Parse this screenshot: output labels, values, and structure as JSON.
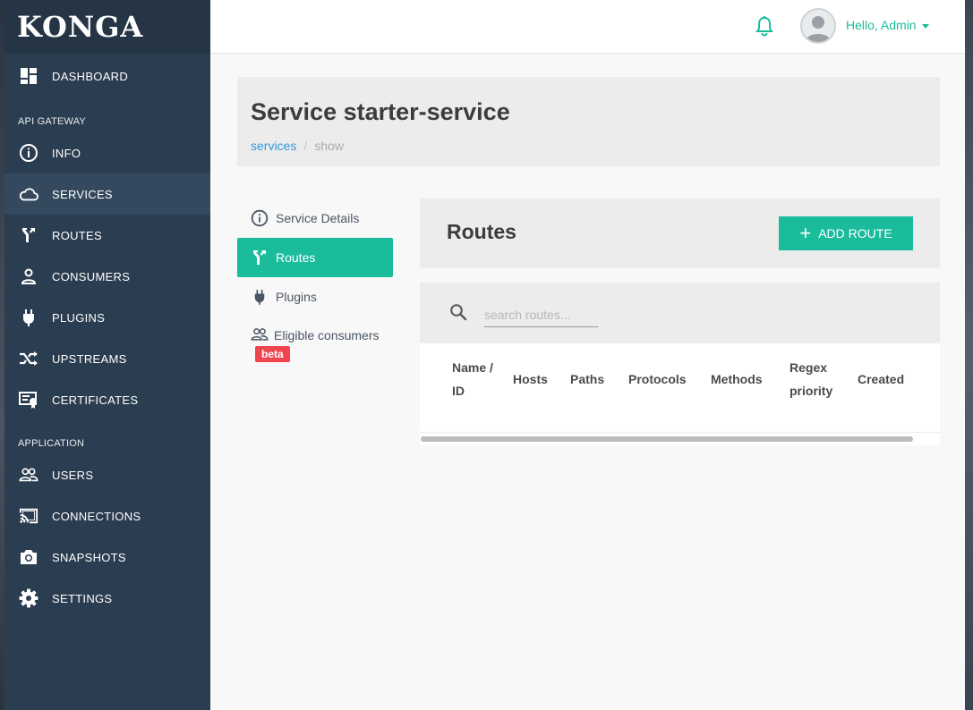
{
  "sidebar": {
    "logo": "KONGA",
    "dashboard": "DASHBOARD",
    "sections": {
      "api_gateway": "API GATEWAY",
      "application": "APPLICATION"
    },
    "gateway_items": [
      {
        "label": "INFO",
        "icon": "info-icon"
      },
      {
        "label": "SERVICES",
        "icon": "cloud-icon",
        "active": true
      },
      {
        "label": "ROUTES",
        "icon": "routes-icon"
      },
      {
        "label": "CONSUMERS",
        "icon": "user-icon"
      },
      {
        "label": "PLUGINS",
        "icon": "plug-icon"
      },
      {
        "label": "UPSTREAMS",
        "icon": "shuffle-icon"
      },
      {
        "label": "CERTIFICATES",
        "icon": "certificate-icon"
      }
    ],
    "app_items": [
      {
        "label": "USERS",
        "icon": "users-icon"
      },
      {
        "label": "CONNECTIONS",
        "icon": "cast-icon"
      },
      {
        "label": "SNAPSHOTS",
        "icon": "camera-icon"
      },
      {
        "label": "SETTINGS",
        "icon": "gear-icon"
      }
    ]
  },
  "topbar": {
    "greeting": "Hello, Admin"
  },
  "header": {
    "title": "Service starter-service",
    "breadcrumb": {
      "link": "services",
      "separator": "/",
      "current": "show"
    }
  },
  "tabs": [
    {
      "label": "Service Details",
      "icon": "info-icon"
    },
    {
      "label": "Routes",
      "icon": "routes-icon",
      "active": true
    },
    {
      "label": "Plugins",
      "icon": "plug-icon"
    },
    {
      "label": "Eligible consumers",
      "icon": "users-icon",
      "badge": "beta"
    }
  ],
  "routes": {
    "title": "Routes",
    "add_button": "ADD ROUTE",
    "search_placeholder": "search routes...",
    "columns": [
      "Name / ID",
      "Hosts",
      "Paths",
      "Protocols",
      "Methods",
      "Regex priority",
      "Created"
    ]
  },
  "colors": {
    "accent": "#1abc9c",
    "sidebar": "#2b3d50",
    "badge": "#f0454f",
    "link": "#3598dc"
  }
}
